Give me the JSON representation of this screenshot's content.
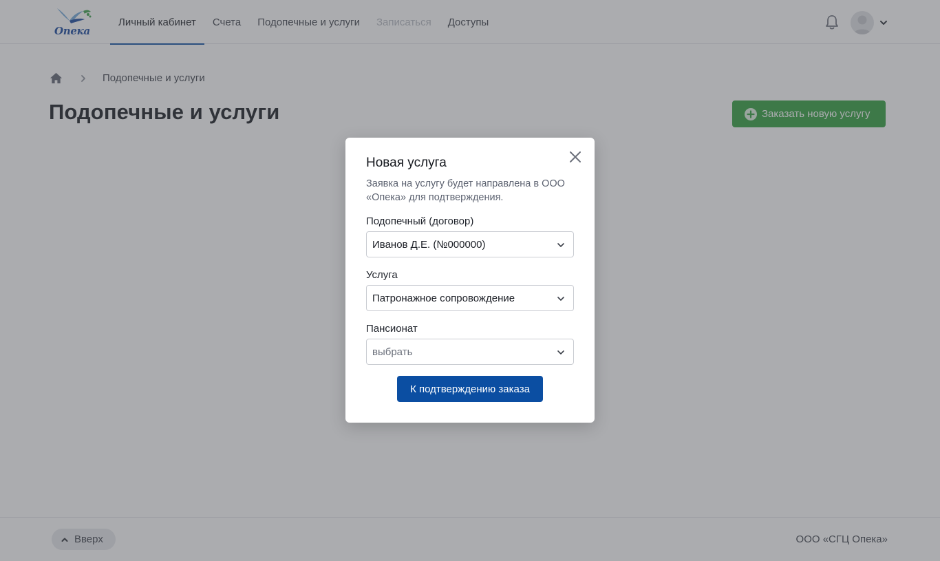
{
  "header": {
    "logo_text": "Опека",
    "nav": [
      {
        "label": "Личный кабинет",
        "state": "active"
      },
      {
        "label": "Счета",
        "state": "normal"
      },
      {
        "label": "Подопечные и услуги",
        "state": "normal"
      },
      {
        "label": "Записаться",
        "state": "disabled"
      },
      {
        "label": "Доступы",
        "state": "normal"
      }
    ],
    "icons": {
      "notifications": "bell-icon",
      "profile": "avatar",
      "menu": "chevron-down-icon"
    }
  },
  "breadcrumb": {
    "home_icon": "home-icon",
    "current": "Подопечные и услуги"
  },
  "page": {
    "title": "Подопечные и услуги",
    "order_button": "Заказать новую услугу"
  },
  "modal": {
    "title": "Новая услуга",
    "description": "Заявка на услугу будет направлена в ООО «Опека» для подтверждения.",
    "fields": [
      {
        "label": "Подопечный (договор)",
        "value": "Иванов Д.Е. (№000000)",
        "is_placeholder": false
      },
      {
        "label": "Услуга",
        "value": "Патронажное сопровождение",
        "is_placeholder": false
      },
      {
        "label": "Пансионат",
        "value": "выбрать",
        "is_placeholder": true
      }
    ],
    "submit": "К подтверждению заказа"
  },
  "footer": {
    "up_button": "Вверх",
    "copyright": "ООО «СГЦ Опека»"
  },
  "colors": {
    "primary": "#0b4ea2",
    "success": "#2c9e3b",
    "overlay": "rgba(80,82,88,0.48)"
  }
}
